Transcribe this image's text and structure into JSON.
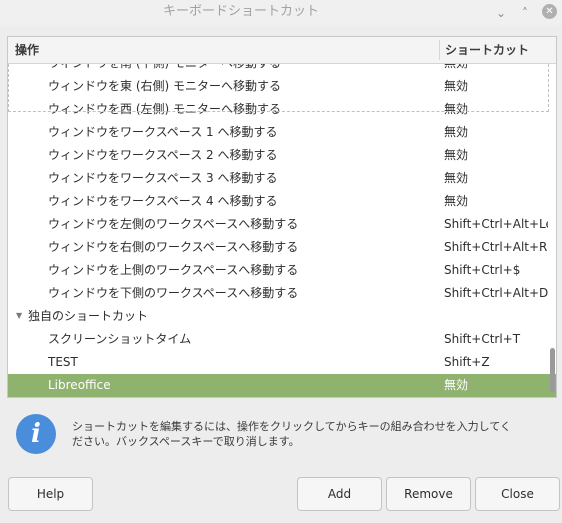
{
  "window": {
    "title": "キーボードショートカット",
    "minimize_glyph": "⌄",
    "maximize_glyph": "˄",
    "close_glyph": "✕"
  },
  "table": {
    "columns": [
      "操作",
      "ショートカット"
    ],
    "rows": [
      {
        "action": "ウィンドウを南 (下側) モニターへ移動する",
        "shortcut": "無効"
      },
      {
        "action": "ウィンドウを東 (右側) モニターへ移動する",
        "shortcut": "無効"
      },
      {
        "action": "ウィンドウを西 (左側) モニターへ移動する",
        "shortcut": "無効"
      },
      {
        "action": "ウィンドウをワークスペース 1 へ移動する",
        "shortcut": "無効"
      },
      {
        "action": "ウィンドウをワークスペース 2 へ移動する",
        "shortcut": "無効"
      },
      {
        "action": "ウィンドウをワークスペース 3 へ移動する",
        "shortcut": "無効"
      },
      {
        "action": "ウィンドウをワークスペース 4 へ移動する",
        "shortcut": "無効"
      },
      {
        "action": "ウィンドウを左側のワークスペースへ移動する",
        "shortcut": "Shift+Ctrl+Alt+Left"
      },
      {
        "action": "ウィンドウを右側のワークスペースへ移動する",
        "shortcut": "Shift+Ctrl+Alt+Right"
      },
      {
        "action": "ウィンドウを上側のワークスペースへ移動する",
        "shortcut": "Shift+Ctrl+$"
      },
      {
        "action": "ウィンドウを下側のワークスペースへ移動する",
        "shortcut": "Shift+Ctrl+Alt+Down"
      }
    ],
    "group": {
      "label": "独自のショートカット",
      "expander_glyph": "▼",
      "rows": [
        {
          "action": "スクリーンショットタイム",
          "shortcut": "Shift+Ctrl+T"
        },
        {
          "action": "TEST",
          "shortcut": "Shift+Z"
        },
        {
          "action": "Libreoffice",
          "shortcut": "無効",
          "selected": true
        }
      ]
    }
  },
  "info": {
    "icon": "info-icon",
    "icon_glyph": "i",
    "text": "ショートカットを編集するには、操作をクリックしてからキーの組み合わせを入力してください。バックスペースキーで取り消します。"
  },
  "buttons": {
    "help": "Help",
    "add": "Add",
    "remove": "Remove",
    "close": "Close"
  },
  "colors": {
    "selection": "#8fb36e",
    "info_icon": "#4a8ddb"
  }
}
